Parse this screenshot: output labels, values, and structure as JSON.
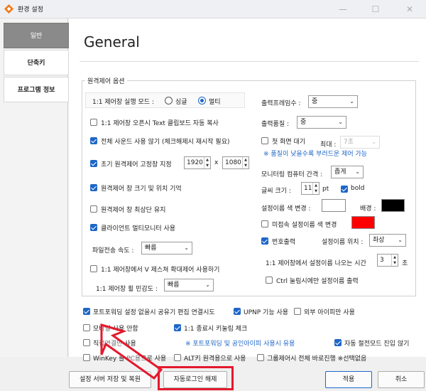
{
  "window": {
    "title": "환경 설정",
    "minimize": "—",
    "maximize": "☐",
    "close": "✕"
  },
  "sidebar": {
    "items": [
      {
        "label": "일반"
      },
      {
        "label": "단축키"
      },
      {
        "label": "프로그램 정보"
      }
    ]
  },
  "page": {
    "heading": "General"
  },
  "remote_group": {
    "title": "원격제어 옵션",
    "mode_label": "1:1 제어창 실행 모드 :",
    "mode_single": "싱글",
    "mode_multi": "멀티",
    "mode_selected": "멀티",
    "clipboard_copy": "1:1 제어창 오픈시 Text 클립보드 자동 복사",
    "disable_sound": "전체 사운드 사용 않기 (체크해제시 재시작 필요)",
    "fixed_size_label": "초기 원격제어 고정창 지정",
    "fixed_width": "1920",
    "fixed_x": "x",
    "fixed_height": "1080",
    "remember_pos": "원격제어 창 크기 및 위치 기억",
    "keep_top": "원격제어 창 최상단 유지",
    "client_multimonitor": "클라이언트 멀티모니터 사용",
    "file_speed_label": "파일전송 속도 :",
    "file_speed_value": "빠름",
    "v_gesture": "1:1 제어창에서 V 제스쳐 확대제어 사용하기",
    "wheel_label": "1:1 제어창 휠 민감도 :",
    "wheel_value": "빠름",
    "output_frames_label": "출력프레임수 :",
    "output_frames_value": "중",
    "output_quality_label": "출력품질 :",
    "output_quality_value": "중",
    "first_screen_wait": "첫 화면 대기",
    "max_label": "최대 :",
    "max_value": "7초",
    "first_screen_note": "※ 품질이 낮을수록 부러드운 제어 가능",
    "monitor_interval_label": "모니터링 컴퓨터 간격 :",
    "monitor_interval_value": "좁게",
    "font_size_label": "글씨 크기 :",
    "font_size_value": "11",
    "font_unit": "pt",
    "bold_label": "bold",
    "name_color_label": "설정이름 색 변경 :",
    "bg_label": "배경 :",
    "unconnected_color": "미접속 설정이름 색 변경",
    "number_output": "번호출력",
    "name_position_label": "설정이름 위치 :",
    "name_position_value": "좌상",
    "show_time_label": "1:1 제어창에서 설정이름 나오는 시간",
    "show_time_value": "3",
    "show_time_unit": "초",
    "ctrl_only": "Ctrl 눌림시에만 설정이름 출력"
  },
  "options": {
    "port_forward_share": "포트포워딩 설정 없을시 공유기 편집 연결시도",
    "upnp": "UPNP 기능 사용",
    "external_ip_only": "외부 아이피만 사용",
    "mobile_no_use": "모바일 사용 안함",
    "keyboard_check": "1:1 종료시 키눌림 체크",
    "direct_connect_only": "직접연결만 사용",
    "forward_note": "※ 포트포워딩 및 공인아이피 사용시 유용",
    "auto_save_mode": "자동 절전모드 진입 않기",
    "winkey_pc": "WinKey 를 PC용으로 사용",
    "alt_remote": "ALT키 원격용으로 사용",
    "group_control": "그룹제어시 전체 바로진행 ※선택없음"
  },
  "footer": {
    "save_restore": "설정 서버 저장 및 복원",
    "auto_login_off": "자동로그인 해제",
    "apply": "적용",
    "cancel": "취소"
  },
  "colors": {
    "accent": "#1e66c8",
    "name_bg": "#000000",
    "unconnected": "#ff0000",
    "annotation": "#e3192d"
  }
}
